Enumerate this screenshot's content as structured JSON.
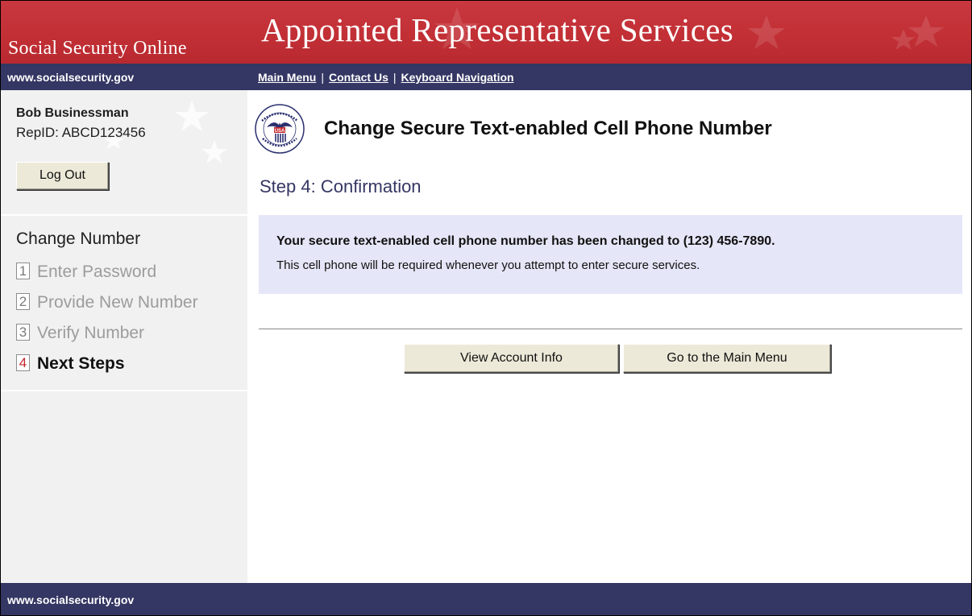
{
  "header": {
    "site_name": "Social Security Online",
    "app_title": "Appointed Representative Services"
  },
  "nav": {
    "url": "www.socialsecurity.gov",
    "links": [
      {
        "label": "Main Menu"
      },
      {
        "label": "Contact Us"
      },
      {
        "label": "Keyboard Navigation"
      }
    ],
    "separator": "|"
  },
  "sidebar": {
    "user_name": "Bob Businessman",
    "rep_id": "RepID:  ABCD123456",
    "logout_label": "Log Out",
    "steps_title": "Change Number",
    "steps": [
      {
        "num": "1",
        "label": "Enter Password",
        "state": "done"
      },
      {
        "num": "2",
        "label": "Provide New Number",
        "state": "done"
      },
      {
        "num": "3",
        "label": "Verify Number",
        "state": "done"
      },
      {
        "num": "4",
        "label": "Next Steps",
        "state": "current"
      }
    ]
  },
  "main": {
    "page_title": "Change Secure Text-enabled Cell Phone Number",
    "step_heading": "Step 4:  Confirmation",
    "message_line1": "Your secure text-enabled cell phone number has been changed to (123) 456-7890.",
    "message_line2": "This cell phone will be required whenever you attempt to enter secure services.",
    "view_account_label": "View Account Info",
    "main_menu_label": "Go to the Main Menu"
  },
  "footer": {
    "url": "www.socialsecurity.gov"
  },
  "colors": {
    "banner_red": "#c23036",
    "nav_navy": "#343663",
    "message_bg": "#e5e6f7",
    "sidebar_bg": "#f1f1f1",
    "active_step_number": "#c4282e"
  },
  "icons": {
    "seal": "ssa-seal-icon",
    "stars": "star-decoration-icon"
  }
}
